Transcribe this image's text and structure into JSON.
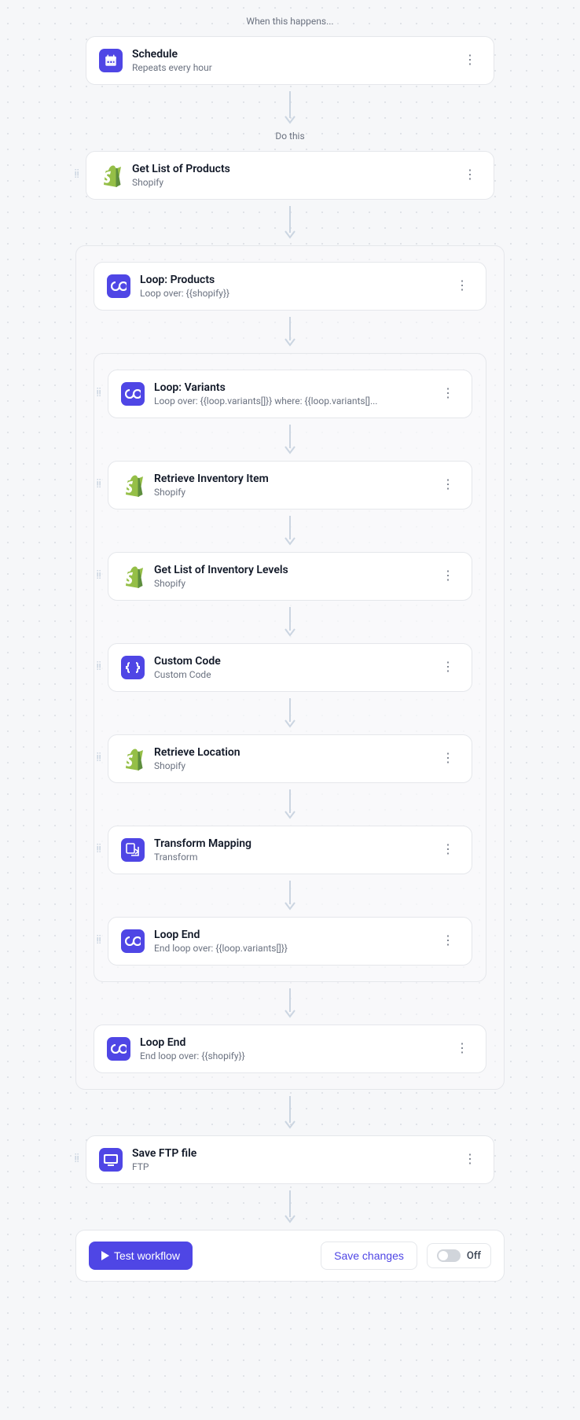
{
  "labels": {
    "trigger": "When this happens...",
    "action": "Do this"
  },
  "trigger": {
    "title": "Schedule",
    "sub": "Repeats every hour"
  },
  "step_products": {
    "title": "Get List of Products",
    "sub": "Shopify"
  },
  "loop_products": {
    "title": "Loop: Products",
    "sub": "Loop over: {{shopify}}"
  },
  "loop_variants": {
    "title": "Loop: Variants",
    "sub": "Loop over: {{loop.variants[]}} where: {{loop.variants[]..."
  },
  "step_inventory_item": {
    "title": "Retrieve Inventory Item",
    "sub": "Shopify"
  },
  "step_inventory_levels": {
    "title": "Get List of Inventory Levels",
    "sub": "Shopify"
  },
  "step_custom_code": {
    "title": "Custom Code",
    "sub": "Custom Code"
  },
  "step_location": {
    "title": "Retrieve Location",
    "sub": "Shopify"
  },
  "step_transform": {
    "title": "Transform Mapping",
    "sub": "Transform"
  },
  "loop_end_variants": {
    "title": "Loop End",
    "sub": "End loop over: {{loop.variants[]}}"
  },
  "loop_end_products": {
    "title": "Loop End",
    "sub": "End loop over: {{shopify}}"
  },
  "step_ftp": {
    "title": "Save FTP file",
    "sub": "FTP"
  },
  "footer": {
    "test": "Test workflow",
    "save": "Save changes",
    "toggle": "Off"
  }
}
